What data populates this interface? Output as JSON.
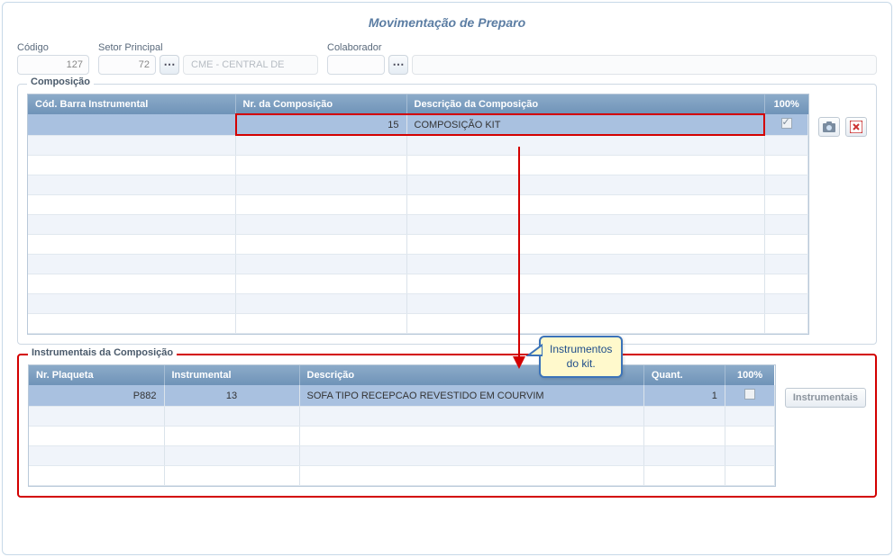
{
  "page": {
    "title": "Movimentação de Preparo"
  },
  "form": {
    "codigo": {
      "label": "Código",
      "value": "127"
    },
    "setor": {
      "label": "Setor Principal",
      "value": "72",
      "desc": "CME - CENTRAL DE"
    },
    "colaborador": {
      "label": "Colaborador",
      "value": ""
    }
  },
  "composicao": {
    "legend": "Composição",
    "headers": {
      "cod_barra": "Cód. Barra Instrumental",
      "nr_comp": "Nr. da Composição",
      "desc_comp": "Descrição da Composição",
      "pct": "100%"
    },
    "row": {
      "cod_barra": "",
      "nr_comp": "15",
      "desc_comp": "COMPOSIÇÃO KIT",
      "pct_checked": true
    }
  },
  "instrumentais": {
    "legend": "Instrumentais da Composição",
    "headers": {
      "nr_plaqueta": "Nr. Plaqueta",
      "instrumental": "Instrumental",
      "descricao": "Descrição",
      "quant": "Quant.",
      "pct": "100%"
    },
    "row": {
      "nr_plaqueta": "P882",
      "instrumental": "13",
      "descricao": "SOFA TIPO RECEPCAO REVESTIDO EM COURVIM",
      "quant": "1",
      "pct_checked": false
    },
    "button": "Instrumentais"
  },
  "callout": {
    "line1": "Instrumentos",
    "line2": "do kit."
  }
}
